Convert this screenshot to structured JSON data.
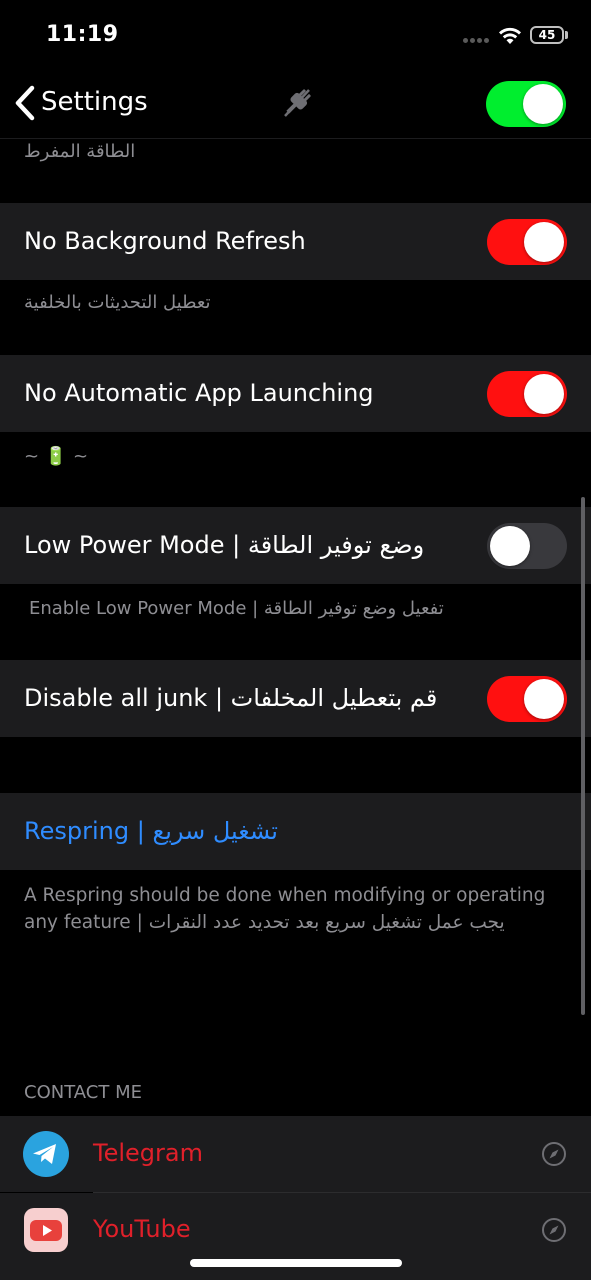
{
  "status_bar": {
    "time": "11:19",
    "battery": "45"
  },
  "nav": {
    "back_label": "Settings",
    "master_toggle_on": true
  },
  "colors": {
    "toggle_on_master": "#00ee2e",
    "toggle_on": "#ff1010",
    "toggle_off": "#39393d",
    "link": "#2f8cff",
    "contact_label": "#e0202a"
  },
  "clipped_footer": "الطاقة المفرط",
  "settings": [
    {
      "label": "No Background Refresh",
      "on": true,
      "footer": "تعطيل التحديثات بالخلفية"
    },
    {
      "label": "No Automatic App Launching",
      "on": true,
      "footer": "~ 🔋 ~"
    },
    {
      "label": "Low Power Mode | وضع توفير الطاقة",
      "on": false,
      "footer": "Enable Low Power Mode | تفعيل وضع توفير الطاقة"
    },
    {
      "label": "Disable all junk | قم بتعطيل المخلفات",
      "on": true
    }
  ],
  "respring": {
    "label": "Respring | تشغيل سريع",
    "description_line1": "A Respring should be done when modifying or operating",
    "description_line2": "any feature | يجب عمل تشغيل سريع بعد تحديد عدد النقرات"
  },
  "contact": {
    "header": "CONTACT ME",
    "items": [
      {
        "label": "Telegram",
        "icon": "telegram-icon"
      },
      {
        "label": "YouTube",
        "icon": "youtube-icon"
      }
    ]
  }
}
